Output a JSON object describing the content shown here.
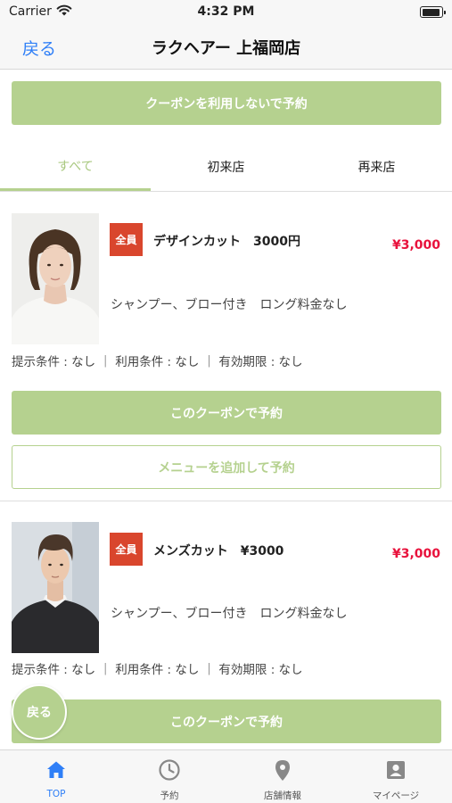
{
  "status_bar": {
    "carrier": "Carrier",
    "time": "4:32 PM",
    "battery_level": 0.95
  },
  "nav": {
    "back_label": "戻る",
    "title": "ラクヘアー 上福岡店"
  },
  "top_button_label": "クーポンを利用しないで予約",
  "tabs": [
    {
      "label": "すべて",
      "active": true
    },
    {
      "label": "初来店",
      "active": false
    },
    {
      "label": "再来店",
      "active": false
    }
  ],
  "coupons": [
    {
      "badge": "全員",
      "name": "デザインカット　3000円",
      "price": "¥3,000",
      "description": "シャンプー、ブロー付き　ロング料金なし",
      "conditions": "提示条件 : なし ｜ 利用条件 : なし ｜ 有効期限 : なし",
      "reserve_label": "このクーポンで予約",
      "add_menu_label": "メニューを追加して予約"
    },
    {
      "badge": "全員",
      "name": "メンズカット　¥3000",
      "price": "¥3,000",
      "description": "シャンプー、ブロー付き　ロング料金なし",
      "conditions": "提示条件 : なし ｜ 利用条件 : なし ｜ 有効期限 : なし",
      "reserve_label": "このクーポンで予約"
    }
  ],
  "floating_back_label": "戻る",
  "tab_bar": [
    {
      "label": "TOP",
      "icon": "home-icon",
      "active": true
    },
    {
      "label": "予約",
      "icon": "clock-icon",
      "active": false
    },
    {
      "label": "店舗情報",
      "icon": "location-pin-icon",
      "active": false
    },
    {
      "label": "マイページ",
      "icon": "profile-card-icon",
      "active": false
    }
  ],
  "colors": {
    "accent_green": "#b5d18f",
    "price_red": "#e8123c",
    "badge_red": "#d9462d",
    "ios_blue": "#2f7ff7"
  }
}
